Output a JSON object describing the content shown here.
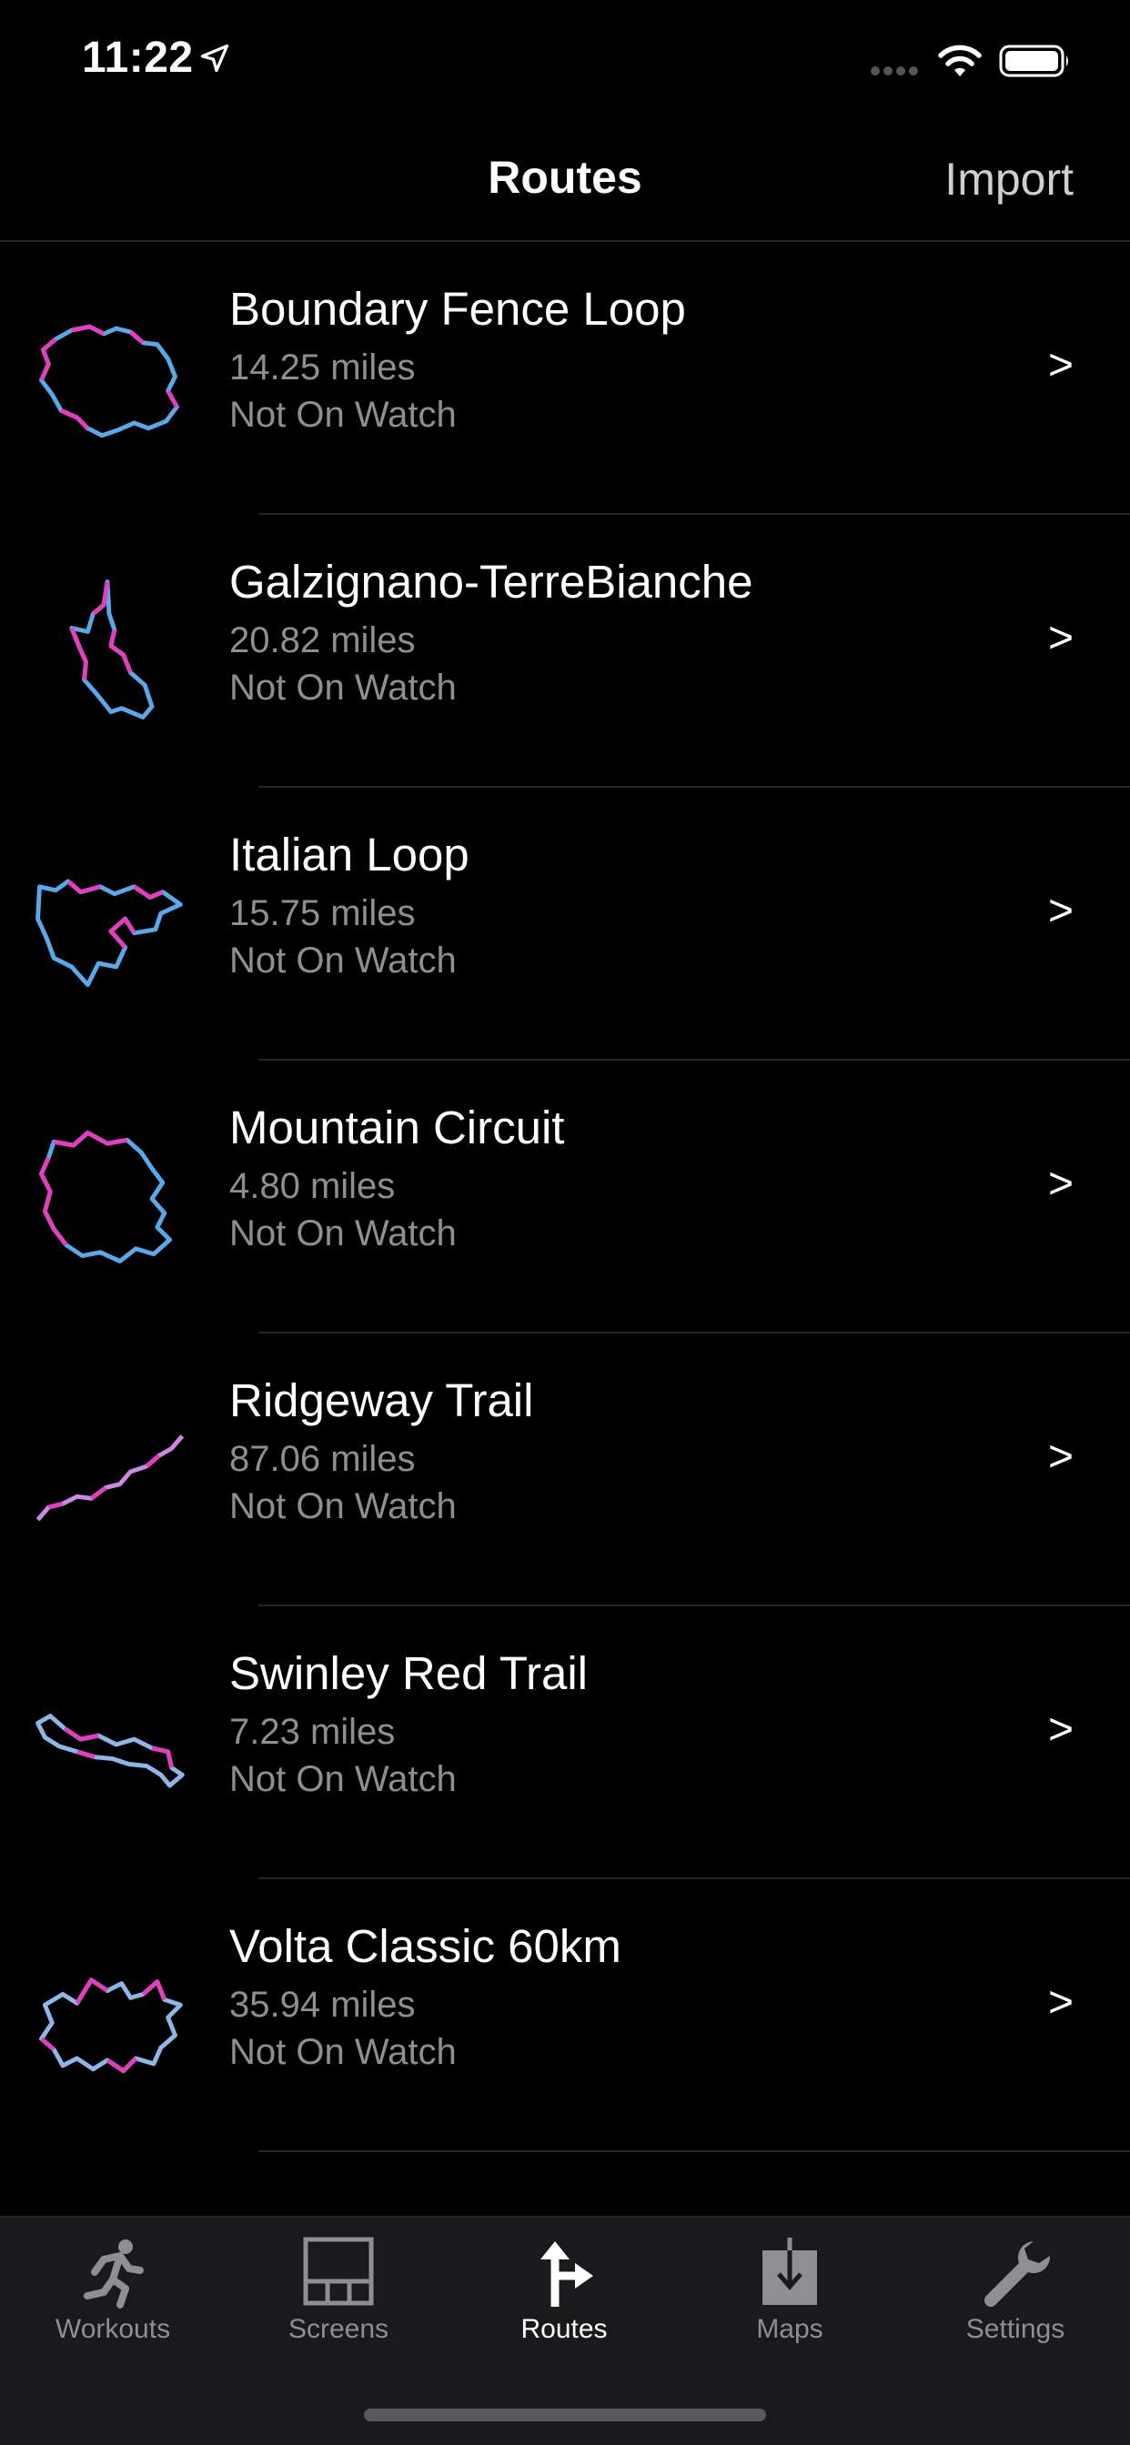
{
  "status_bar": {
    "time": "11:22",
    "icons": [
      "location-arrow-icon",
      "cellular-signal-icon",
      "wifi-icon",
      "battery-icon"
    ]
  },
  "nav": {
    "title": "Routes",
    "import_label": "Import"
  },
  "routes": [
    {
      "name": "Boundary Fence Loop",
      "distance": "14.25 miles",
      "status": "Not On Watch",
      "chevron": ">"
    },
    {
      "name": "Galzignano-TerreBianche",
      "distance": "20.82 miles",
      "status": "Not On Watch",
      "chevron": ">"
    },
    {
      "name": "Italian Loop",
      "distance": "15.75 miles",
      "status": "Not On Watch",
      "chevron": ">"
    },
    {
      "name": "Mountain Circuit",
      "distance": "4.80 miles",
      "status": "Not On Watch",
      "chevron": ">"
    },
    {
      "name": "Ridgeway Trail",
      "distance": "87.06 miles",
      "status": "Not On Watch",
      "chevron": ">"
    },
    {
      "name": "Swinley Red Trail",
      "distance": "7.23 miles",
      "status": "Not On Watch",
      "chevron": ">"
    },
    {
      "name": "Volta Classic 60km",
      "distance": "35.94 miles",
      "status": "Not On Watch",
      "chevron": ">"
    }
  ],
  "tabs": [
    {
      "label": "Workouts",
      "icon": "running-figure-icon"
    },
    {
      "label": "Screens",
      "icon": "screen-grid-icon"
    },
    {
      "label": "Routes",
      "icon": "route-arrow-icon",
      "active": true
    },
    {
      "label": "Maps",
      "icon": "download-map-icon"
    },
    {
      "label": "Settings",
      "icon": "wrench-icon"
    }
  ],
  "colors": {
    "background": "#000000",
    "route_pink": "#e23fbe",
    "route_blue": "#5aa8e8",
    "secondary_text": "#8e8e93",
    "tab_bar": "#1a1a1c"
  }
}
